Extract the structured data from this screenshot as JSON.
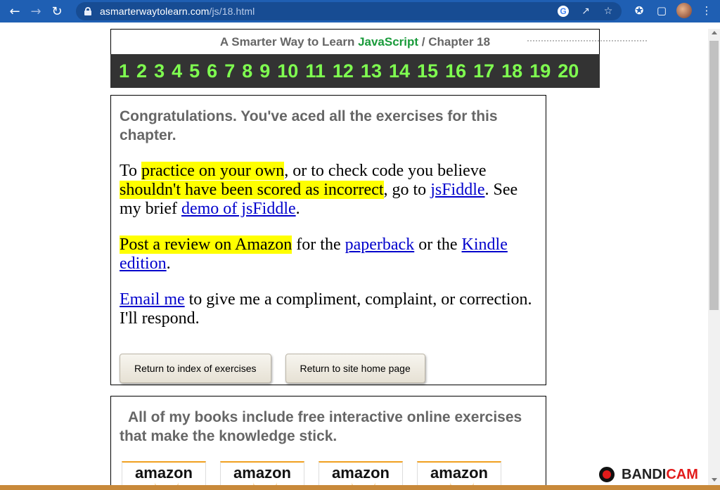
{
  "browser": {
    "url_host": "asmarterwaytolearn.com",
    "url_path": "/js/18.html"
  },
  "header": {
    "title_prefix": "A Smarter Way to Learn ",
    "title_js": "JavaScript",
    "title_suffix": "  /  Chapter 18"
  },
  "chapters": [
    "1",
    "2",
    "3",
    "4",
    "5",
    "6",
    "7",
    "8",
    "9",
    "10",
    "11",
    "12",
    "13",
    "14",
    "15",
    "16",
    "17",
    "18",
    "19",
    "20"
  ],
  "main": {
    "congrats": "Congratulations. You've aced all the exercises for this chapter.",
    "p1_a": "To ",
    "p1_hl1": "practice on your own",
    "p1_b": ", or to check code you believe ",
    "p1_hl2": "shouldn't have been scored as incorrect",
    "p1_c": ", go to ",
    "p1_link_jsfiddle": "jsFiddle",
    "p1_d": ". See my brief ",
    "p1_link_demo": "demo of jsFiddle",
    "p1_e": ".",
    "p2_hl": "Post a review on Amazon",
    "p2_a": " for the ",
    "p2_link_paperback": "paperback",
    "p2_b": " or the ",
    "p2_link_kindle": "Kindle edition",
    "p2_c": ".",
    "p3_link_email": "Email me",
    "p3_a": " to give me a compliment, complaint, or correction. I'll respond.",
    "btn_index": "Return to index of exercises",
    "btn_home": "Return to site home page"
  },
  "books": {
    "text": "All of my books include free interactive online exercises that make the knowledge stick.",
    "amazon_labels": [
      "amazon",
      "amazon",
      "amazon",
      "amazon"
    ]
  },
  "watermark": {
    "brand_a": "BANDI",
    "brand_b": "CAM"
  },
  "colors": {
    "chrome": "#1f5fb3",
    "chapter_bar": "#333333",
    "chapter_num": "#7fff50",
    "js_green": "#1a9b3b",
    "highlight": "#ffff00"
  }
}
